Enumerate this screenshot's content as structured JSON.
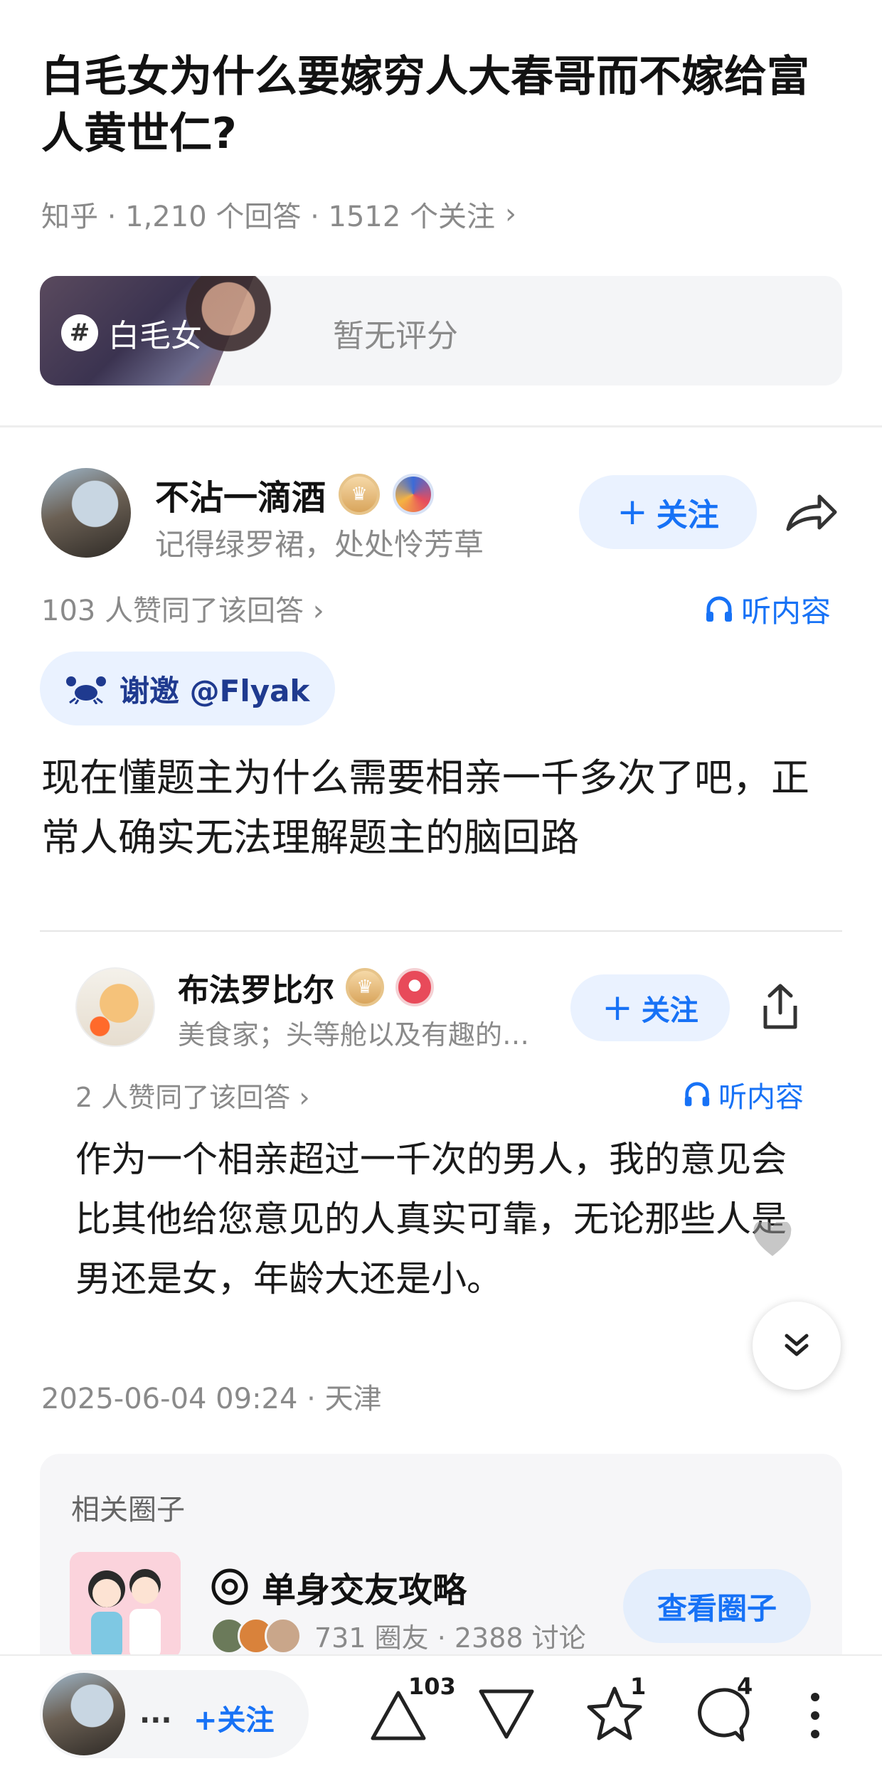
{
  "question": {
    "title": "白毛女为什么要嫁穷人大春哥而不嫁给富人黄世仁?",
    "meta": "知乎 · 1,210 个回答 · 1512 个关注",
    "meta_chevron": "›"
  },
  "topic": {
    "hash_symbol": "#",
    "name": "白毛女",
    "score": "暂无评分"
  },
  "answer": {
    "author_name": "不沾一滴酒",
    "author_bio": "记得绿罗裙，处处怜芳草",
    "follow_label": "关注",
    "plus": "+",
    "votes": "103 人赞同了该回答 ›",
    "listen_label": "听内容",
    "invite_label": "谢邀 @Flyak",
    "content": "现在懂题主为什么需要相亲一千多次了吧，正常人确实无法理解题主的脑回路"
  },
  "quoted_answer": {
    "author_name": "布法罗比尔",
    "author_bio": "美食家；头等舱以及有趣的…",
    "follow_label": "关注",
    "plus": "+",
    "votes": "2 人赞同了该回答 ›",
    "listen_label": "听内容",
    "content": "作为一个相亲超过一千次的男人，我的意见会比其他给您意见的人真实可靠，无论那些人是男还是女，年龄大还是小。"
  },
  "post_time": "2025-06-04 09:24 · 天津",
  "related_circle": {
    "heading": "相关圈子",
    "title": "单身交友攻略",
    "stats": "731 圈友 · 2388 讨论",
    "button": "查看圈子"
  },
  "bottom_bar": {
    "ellipsis": "...",
    "follow_label": "+关注",
    "upvote_count": "103",
    "star_count": "1",
    "comment_count": "4"
  },
  "colors": {
    "accent": "#1772f6",
    "follow_bg": "#eaf2ff",
    "muted_text": "#8a8a8a"
  },
  "icons": [
    "hash-icon",
    "crown-badge-icon",
    "share-arrow-icon",
    "headphones-icon",
    "crab-icon",
    "upload-share-icon",
    "heart-icon",
    "double-chevron-down-icon",
    "target-icon",
    "upvote-triangle-icon",
    "downvote-triangle-icon",
    "star-icon",
    "comment-icon",
    "more-vertical-icon"
  ]
}
